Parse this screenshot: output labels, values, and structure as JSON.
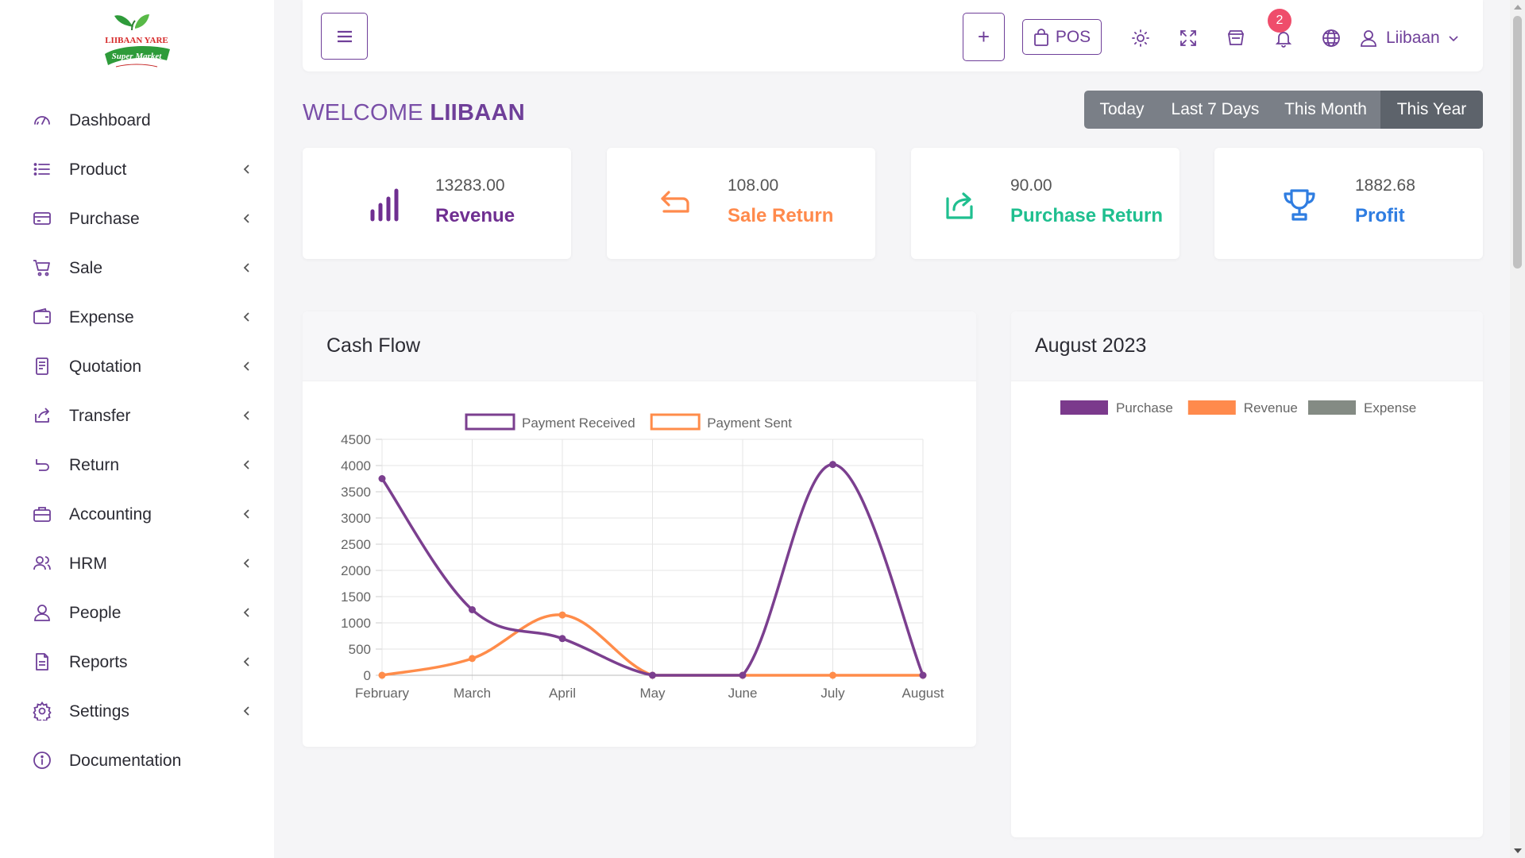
{
  "app": {
    "logo_line1": "LIIBAAN YARE",
    "logo_line2": "Super Market"
  },
  "sidebar": {
    "items": [
      {
        "label": "Dashboard",
        "icon": "dashboard-icon",
        "has_submenu": false
      },
      {
        "label": "Product",
        "icon": "list-icon",
        "has_submenu": true
      },
      {
        "label": "Purchase",
        "icon": "credit-card-icon",
        "has_submenu": true
      },
      {
        "label": "Sale",
        "icon": "cart-icon",
        "has_submenu": true
      },
      {
        "label": "Expense",
        "icon": "wallet-icon",
        "has_submenu": true
      },
      {
        "label": "Quotation",
        "icon": "document-icon",
        "has_submenu": true
      },
      {
        "label": "Transfer",
        "icon": "share-icon",
        "has_submenu": true
      },
      {
        "label": "Return",
        "icon": "return-icon",
        "has_submenu": true
      },
      {
        "label": "Accounting",
        "icon": "briefcase-icon",
        "has_submenu": true
      },
      {
        "label": "HRM",
        "icon": "users-icon",
        "has_submenu": true
      },
      {
        "label": "People",
        "icon": "user-icon",
        "has_submenu": true
      },
      {
        "label": "Reports",
        "icon": "report-icon",
        "has_submenu": true
      },
      {
        "label": "Settings",
        "icon": "gear-icon",
        "has_submenu": true
      },
      {
        "label": "Documentation",
        "icon": "info-icon",
        "has_submenu": false
      }
    ]
  },
  "topbar": {
    "plus_label": "+",
    "pos_label": "POS",
    "notification_count": "2",
    "user_name": "Liibaan"
  },
  "welcome": {
    "prefix": "WELCOME",
    "name": "LIIBAAN"
  },
  "date_range": {
    "options": [
      "Today",
      "Last 7 Days",
      "This Month",
      "This Year"
    ],
    "selected": "This Year"
  },
  "stats": [
    {
      "value": "13283.00",
      "label": "Revenue",
      "color": "#6f2f91",
      "icon": "bar-chart-icon"
    },
    {
      "value": "108.00",
      "label": "Sale Return",
      "color": "#ff8a4c",
      "icon": "undo-icon"
    },
    {
      "value": "90.00",
      "label": "Purchase Return",
      "color": "#1fbf8f",
      "icon": "redo-box-icon"
    },
    {
      "value": "1882.68",
      "label": "Profit",
      "color": "#2f7de1",
      "icon": "trophy-icon"
    }
  ],
  "cash_flow": {
    "title": "Cash Flow"
  },
  "month_panel": {
    "title": "August 2023"
  },
  "colors": {
    "brand": "#6f3f99",
    "series_received": "#7b3f8f",
    "series_sent": "#ff8c4a",
    "purchase": "#7b3a8c",
    "revenue": "#ff8a4c",
    "expense": "#848b84"
  },
  "chart_data": [
    {
      "type": "line",
      "title": "Cash Flow",
      "categories": [
        "February",
        "March",
        "April",
        "May",
        "June",
        "July",
        "August"
      ],
      "series": [
        {
          "name": "Payment Received",
          "values": [
            3750,
            1250,
            700,
            0,
            0,
            4020,
            0
          ]
        },
        {
          "name": "Payment Sent",
          "values": [
            0,
            320,
            1150,
            0,
            0,
            0,
            0
          ]
        }
      ],
      "ylim": [
        0,
        4500
      ],
      "yticks": [
        0,
        500,
        1000,
        1500,
        2000,
        2500,
        3000,
        3500,
        4000,
        4500
      ],
      "grid": true,
      "legend": "top"
    },
    {
      "type": "pie",
      "title": "August 2023",
      "legend_entries": [
        "Purchase",
        "Revenue",
        "Expense"
      ],
      "values": [],
      "legend": "top"
    }
  ]
}
